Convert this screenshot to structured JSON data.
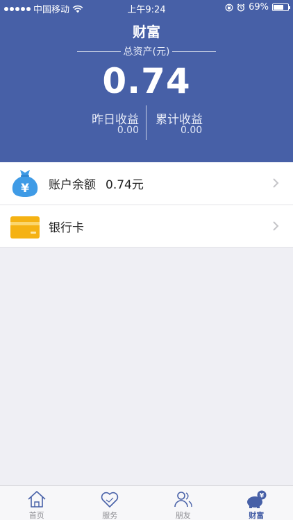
{
  "status_bar": {
    "carrier": "中国移动",
    "time": "上午9:24",
    "battery": "69%",
    "battery_level": 0.69
  },
  "header": {
    "title": "财富",
    "total_label": "总资产(元)",
    "total_value": "0.74",
    "yesterday_label": "昨日收益",
    "yesterday_value": "0.00",
    "cumulative_label": "累计收益",
    "cumulative_value": "0.00"
  },
  "list": {
    "balance_label": "账户余额",
    "balance_value": "0.74元",
    "bank_card_label": "银行卡"
  },
  "tabs": [
    {
      "label": "首页",
      "icon": "home-icon",
      "active": false
    },
    {
      "label": "服务",
      "icon": "heart-icon",
      "active": false
    },
    {
      "label": "朋友",
      "icon": "friends-icon",
      "active": false
    },
    {
      "label": "财富",
      "icon": "piggy-bank-icon",
      "active": true
    }
  ],
  "colors": {
    "header_bg": "#4760a7",
    "accent": "#4760a7",
    "money_bag": "#3f9be6",
    "bank_card": "#f5b213"
  },
  "icons": {
    "money_bag_symbol": "¥"
  }
}
